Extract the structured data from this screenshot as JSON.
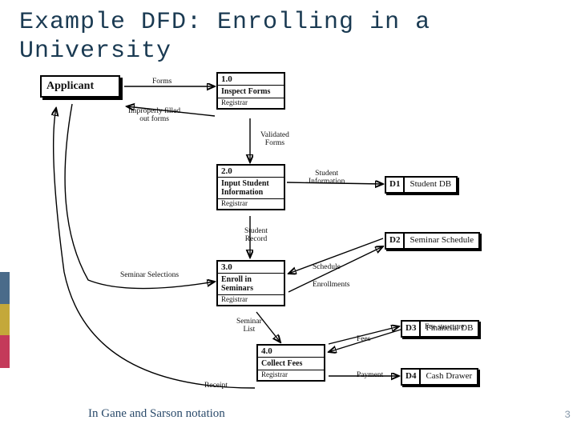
{
  "title": "Example DFD: Enrolling in a University",
  "caption": "In Gane and Sarson notation",
  "page_number": "3",
  "entities": {
    "applicant": "Applicant"
  },
  "processes": {
    "p1": {
      "id": "1.0",
      "name": "Inspect Forms",
      "actor": "Registrar"
    },
    "p2": {
      "id": "2.0",
      "name": "Input Student Information",
      "actor": "Registrar"
    },
    "p3": {
      "id": "3.0",
      "name": "Enroll in Seminars",
      "actor": "Registrar"
    },
    "p4": {
      "id": "4.0",
      "name": "Collect Fees",
      "actor": "Registrar"
    }
  },
  "datastores": {
    "d1": {
      "id": "D1",
      "name": "Student DB"
    },
    "d2": {
      "id": "D2",
      "name": "Seminar Schedule"
    },
    "d3": {
      "id": "D3",
      "name": "Financial DB"
    },
    "d4": {
      "id": "D4",
      "name": "Cash Drawer"
    }
  },
  "flows": {
    "forms": "Forms",
    "improper": "Improperly filled\nout forms",
    "validated": "Validated\nForms",
    "studentinfo": "Student\nInformation",
    "studentrecord": "Student\nRecord",
    "seminarsel": "Seminar Selections",
    "schedule": "Schedule",
    "enrollments": "Enrollments",
    "seminarlist": "Seminar\nList",
    "fees": "Fees",
    "feestructure": "Fee structure",
    "receipt": "Receipt",
    "payment": "Payment"
  }
}
